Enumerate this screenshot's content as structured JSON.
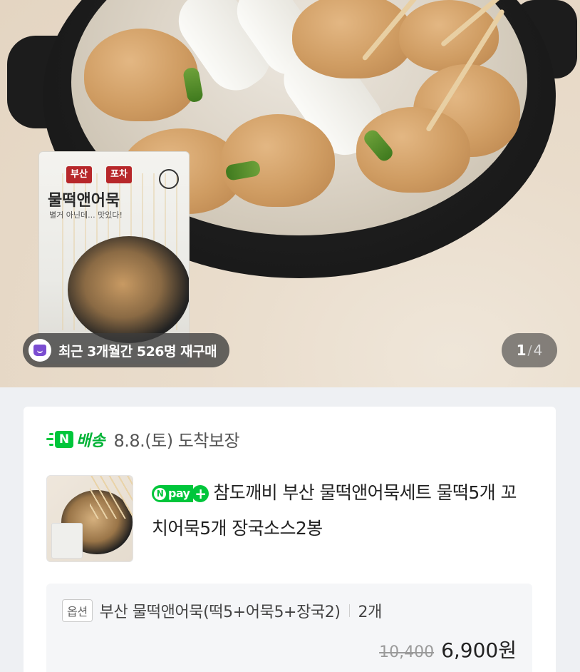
{
  "hero": {
    "package": {
      "tags": [
        "부산",
        "포차"
      ],
      "title": "물떡앤어묵",
      "subtitle": "별거 아닌데... 맛있다!"
    },
    "repurchase_badge": "최근 3개월간 526명 재구매",
    "pager": {
      "current": "1",
      "separator": "/",
      "total": "4"
    }
  },
  "delivery": {
    "logo_letter": "N",
    "logo_word": "배송",
    "text": "8.8.(토) 도착보장"
  },
  "product": {
    "npay_label": "pay",
    "npay_n": "N",
    "npay_plus": "+",
    "title": "참도깨비 부산 물떡앤어묵세트 물떡5개 꼬치어묵5개 장국소스2봉"
  },
  "option": {
    "tag": "옵션",
    "name": "부산 물떡앤어묵(떡5+어묵5+장국2)",
    "quantity": "2개",
    "original_price": "10,400",
    "sale_price": "6,900원"
  },
  "colors": {
    "naver_green": "#00c63b",
    "badge_purple": "#7b4dd1"
  }
}
